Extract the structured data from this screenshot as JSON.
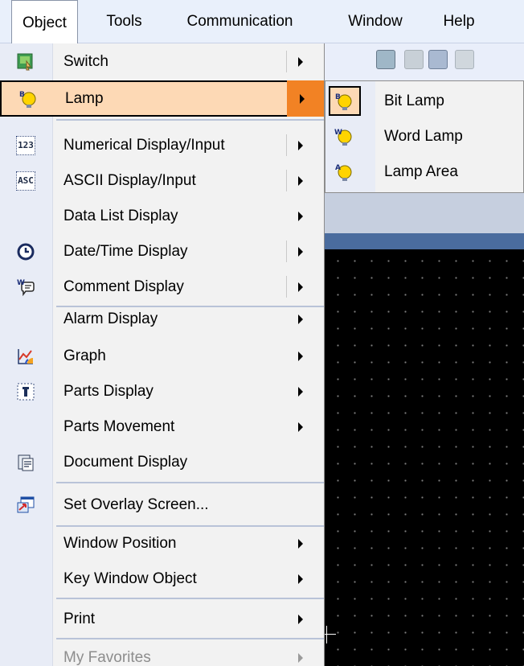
{
  "menubar": {
    "items": [
      {
        "label": "Object",
        "active": true
      },
      {
        "label": "Tools",
        "active": false
      },
      {
        "label": "Communication",
        "active": false
      },
      {
        "label": "Window",
        "active": false
      },
      {
        "label": "Help",
        "active": false
      }
    ]
  },
  "menu": {
    "items": [
      {
        "label": "Switch",
        "icon": "switch-icon",
        "has_submenu": true
      },
      {
        "label": "Lamp",
        "icon": "lamp-icon",
        "has_submenu": true,
        "highlighted": true
      },
      {
        "label": "Numerical Display/Input",
        "icon": "numerical-display-icon",
        "icon_text": "123",
        "has_submenu": true
      },
      {
        "label": "ASCII Display/Input",
        "icon": "ascii-display-icon",
        "icon_text": "ASC",
        "has_submenu": true
      },
      {
        "label": "Data List Display",
        "icon": "",
        "has_submenu": true
      },
      {
        "label": "Date/Time Display",
        "icon": "clock-icon",
        "has_submenu": true
      },
      {
        "label": "Comment Display",
        "icon": "comment-icon",
        "has_submenu": true
      },
      {
        "label": "Alarm Display",
        "icon": "",
        "has_submenu": true
      },
      {
        "label": "Graph",
        "icon": "graph-icon",
        "has_submenu": true
      },
      {
        "label": "Parts Display",
        "icon": "parts-display-icon",
        "has_submenu": true
      },
      {
        "label": "Parts Movement",
        "icon": "",
        "has_submenu": true
      },
      {
        "label": "Document Display",
        "icon": "document-display-icon",
        "has_submenu": false
      },
      {
        "label": "Set Overlay Screen...",
        "icon": "overlay-screen-icon",
        "has_submenu": false
      },
      {
        "label": "Window Position",
        "icon": "",
        "has_submenu": true
      },
      {
        "label": "Key Window Object",
        "icon": "",
        "has_submenu": true
      },
      {
        "label": "Print",
        "icon": "",
        "has_submenu": true
      },
      {
        "label": "My Favorites",
        "icon": "",
        "has_submenu": true,
        "disabled": true
      }
    ]
  },
  "submenu": {
    "items": [
      {
        "label": "Bit Lamp",
        "icon": "bit-lamp-icon",
        "icon_text": "B",
        "highlighted": true
      },
      {
        "label": "Word Lamp",
        "icon": "word-lamp-icon",
        "icon_text": "W"
      },
      {
        "label": "Lamp Area",
        "icon": "lamp-area-icon",
        "icon_text": "A"
      }
    ]
  },
  "colors": {
    "menu_bg": "#f2f2f2",
    "gutter_bg": "#e8ecf6",
    "hover_bg": "#fdd9b5",
    "hover_arrow_bg": "#f28224",
    "canvas_bg": "#000000"
  }
}
